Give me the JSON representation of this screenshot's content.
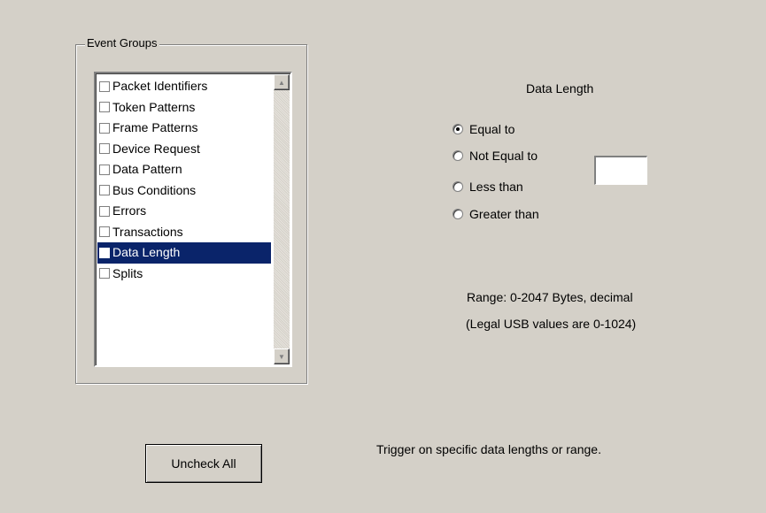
{
  "event_groups": {
    "title": "Event Groups",
    "items": [
      {
        "label": "Packet Identifiers",
        "checked": false
      },
      {
        "label": "Token Patterns",
        "checked": false
      },
      {
        "label": "Frame Patterns",
        "checked": false
      },
      {
        "label": "Device Request",
        "checked": false
      },
      {
        "label": "Data Pattern",
        "checked": false
      },
      {
        "label": "Bus Conditions",
        "checked": false
      },
      {
        "label": "Errors",
        "checked": false
      },
      {
        "label": "Transactions",
        "checked": false
      },
      {
        "label": "Data Length",
        "checked": false,
        "selected": true
      },
      {
        "label": "Splits",
        "checked": false
      }
    ],
    "scroll_up_icon": "scroll-up-arrow",
    "scroll_down_icon": "scroll-down-arrow"
  },
  "data_length": {
    "heading": "Data Length",
    "options": [
      {
        "label": "Equal to",
        "selected": true
      },
      {
        "label": "Not Equal to",
        "selected": false
      },
      {
        "label": "Less than",
        "selected": false
      },
      {
        "label": "Greater than",
        "selected": false
      }
    ],
    "value": "",
    "range_text": "Range:  0-2047 Bytes, decimal",
    "legal_text": "(Legal USB values are 0-1024)"
  },
  "uncheck_all_label": "Uncheck All",
  "description": "Trigger on specific data lengths or range.",
  "colors": {
    "background": "#d4d0c8",
    "selection": "#0a246a"
  }
}
